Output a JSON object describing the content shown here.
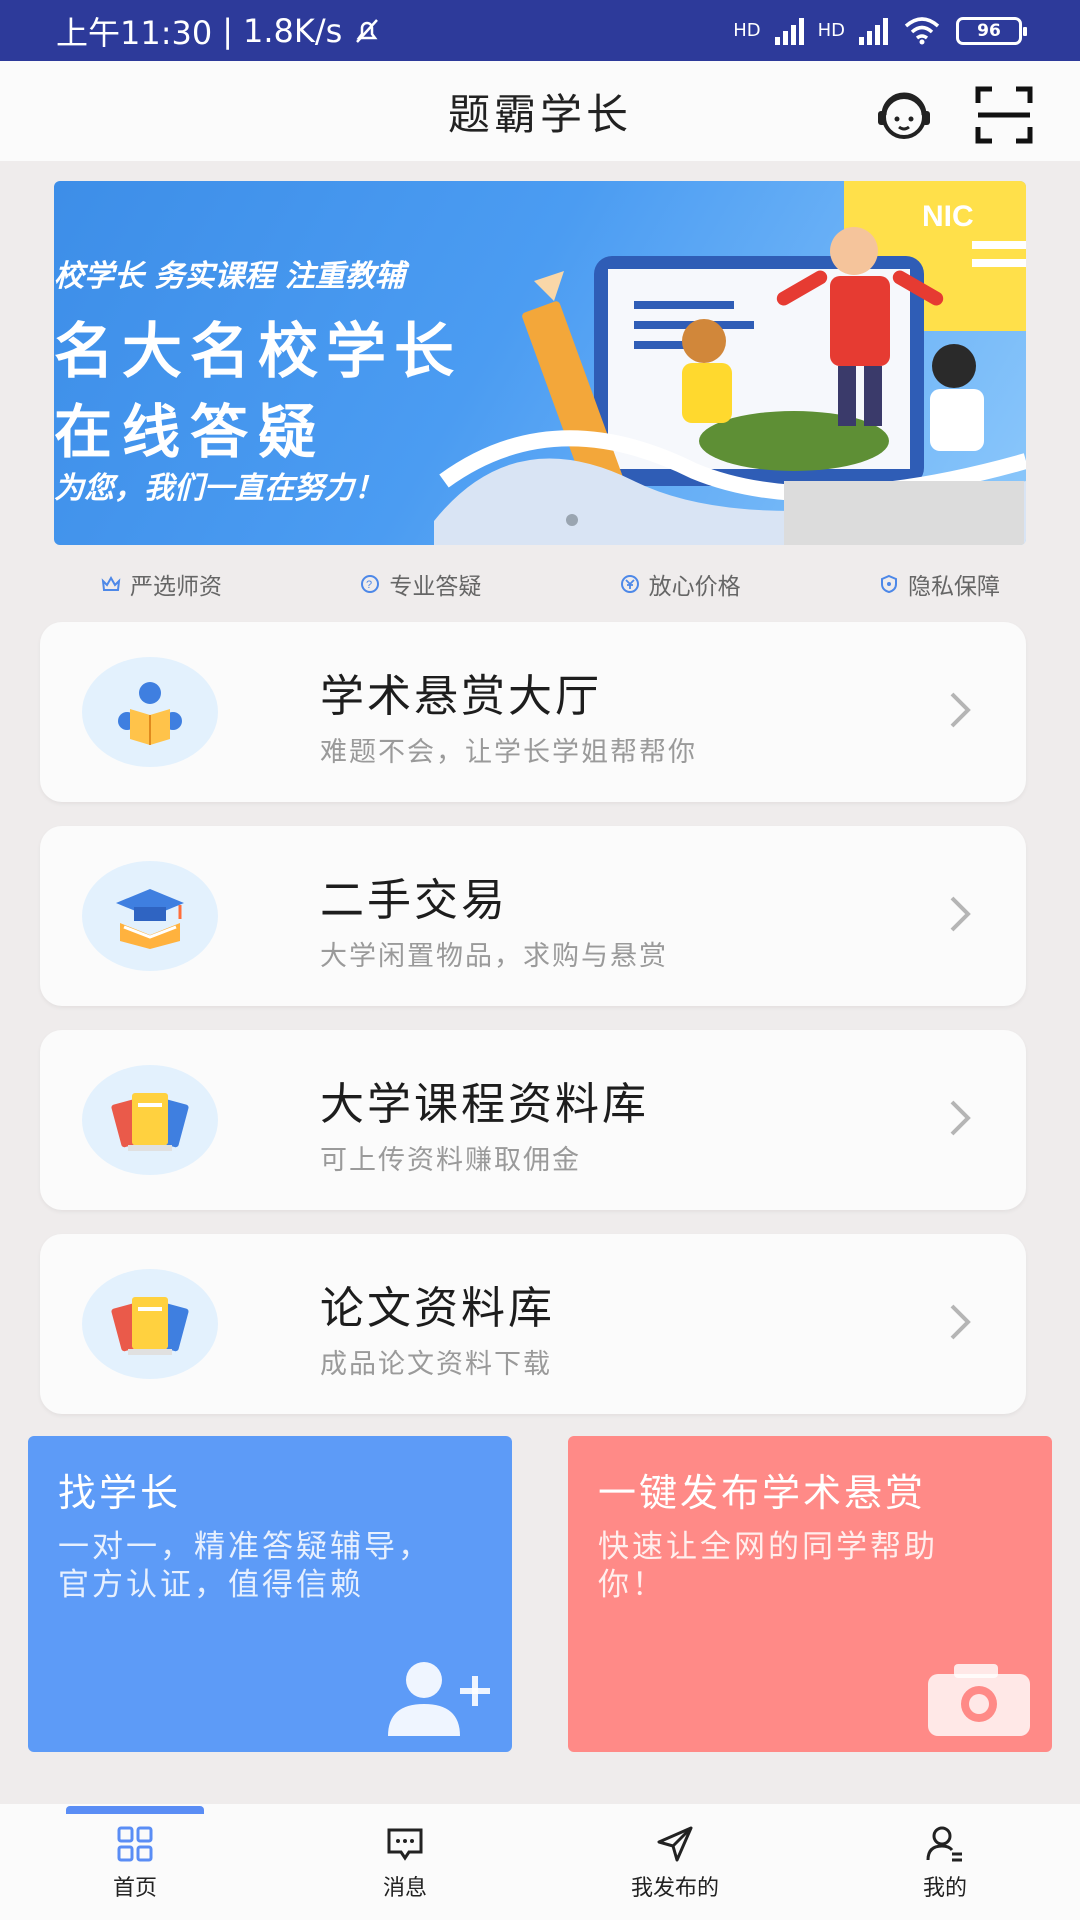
{
  "status_bar": {
    "time": "上午11:30",
    "separator": "|",
    "speed": "1.8K/s",
    "sim1": "HD",
    "sim2": "HD",
    "battery": "96"
  },
  "header": {
    "title": "题霸学长",
    "icons": [
      "customer-service-icon",
      "scan-icon"
    ]
  },
  "banner": {
    "line1": "校学长  务实课程  注重教辅",
    "line2": "名大名校学长",
    "line3": "在线答疑",
    "line4": "为您，我们一直在努力！",
    "corner_text": "NIC"
  },
  "features": [
    {
      "label": "严选师资",
      "icon": "crown-icon"
    },
    {
      "label": "专业答疑",
      "icon": "question-icon"
    },
    {
      "label": "放心价格",
      "icon": "yen-icon"
    },
    {
      "label": "隐私保障",
      "icon": "shield-icon"
    }
  ],
  "menu": [
    {
      "title": "学术悬赏大厅",
      "subtitle": "难题不会，让学长学姐帮帮你",
      "icon": "reading-person-icon"
    },
    {
      "title": "二手交易",
      "subtitle": "大学闲置物品，求购与悬赏",
      "icon": "graduation-cap-icon"
    },
    {
      "title": "大学课程资料库",
      "subtitle": "可上传资料赚取佣金",
      "icon": "books-icon"
    },
    {
      "title": "论文资料库",
      "subtitle": "成品论文资料下载",
      "icon": "books-icon"
    }
  ],
  "actions": {
    "find": {
      "title": "找学长",
      "subtitle": "一对一，精准答疑辅导，官方认证，值得信赖"
    },
    "post": {
      "title": "一键发布学术悬赏",
      "subtitle": "快速让全网的同学帮助你！"
    }
  },
  "nav": [
    {
      "label": "首页",
      "icon": "home-grid-icon",
      "active": true
    },
    {
      "label": "消息",
      "icon": "message-icon",
      "active": false
    },
    {
      "label": "我发布的",
      "icon": "send-icon",
      "active": false
    },
    {
      "label": "我的",
      "icon": "profile-icon",
      "active": false
    }
  ],
  "colors": {
    "status_bar": "#2d3a9a",
    "accent": "#5a8df5",
    "find_card": "#5d9bf7",
    "post_card": "#ff8a87",
    "page_bg": "#efecec"
  }
}
